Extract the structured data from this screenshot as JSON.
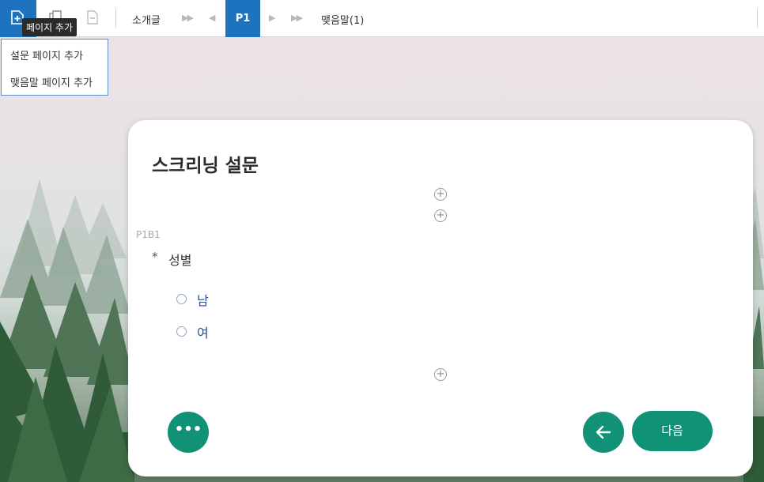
{
  "toolbar": {
    "intro_label": "소개글",
    "current_page": "P1",
    "closing_label": "맺음말(1)"
  },
  "tooltip": {
    "text": "페이지 추가"
  },
  "add_menu": {
    "items": [
      {
        "label": "설문 페이지 추가"
      },
      {
        "label": "맺음말 페이지 추가"
      }
    ]
  },
  "survey": {
    "title": "스크리닝 설문",
    "question": {
      "id": "P1B1",
      "required_mark": "*",
      "text": "성별",
      "options": [
        {
          "label": "남"
        },
        {
          "label": "여"
        }
      ]
    },
    "add_symbol": "+",
    "more_label": "•••",
    "next_label": "다음"
  },
  "colors": {
    "toolbar_accent": "#1e73be",
    "button_green": "#119277",
    "option_text": "#2a4f8a"
  },
  "icons": {
    "add_page": "add-page-icon",
    "copy_page": "copy-page-icon",
    "remove_page": "remove-page-icon",
    "first": "first-page-icon",
    "prev": "prev-page-icon",
    "next": "next-page-icon",
    "last": "last-page-icon",
    "back": "arrow-left-icon"
  }
}
